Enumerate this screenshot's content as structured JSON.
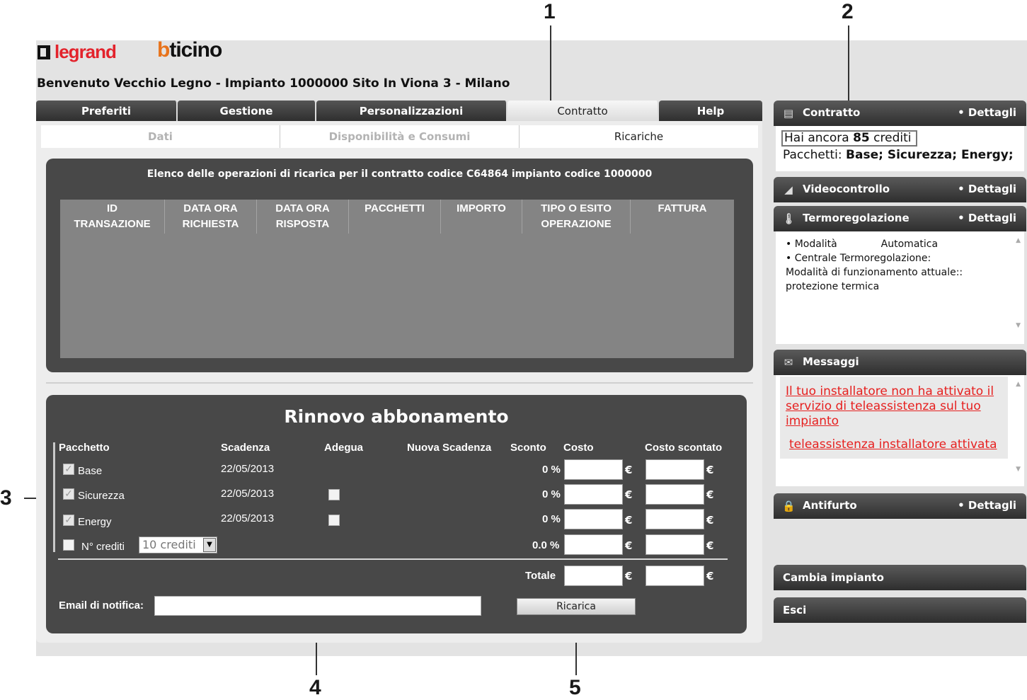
{
  "callouts": [
    "1",
    "2",
    "3",
    "4",
    "5"
  ],
  "brand": {
    "legrand": "legrand",
    "bticino_b": "b",
    "bticino_rest": "ticino"
  },
  "header": {
    "welcome": "Benvenuto Vecchio Legno - Impianto 1000000 Sito In Viona 3 - Milano"
  },
  "main_tabs": [
    {
      "label": "Preferiti",
      "active": false
    },
    {
      "label": "Gestione",
      "active": false
    },
    {
      "label": "Personalizzazioni",
      "active": false
    },
    {
      "label": "Contratto",
      "active": true
    },
    {
      "label": "Help",
      "active": false
    }
  ],
  "sub_tabs": [
    {
      "label": "Dati",
      "active": false
    },
    {
      "label": "Disponibilità e Consumi",
      "active": false
    },
    {
      "label": "Ricariche",
      "active": true
    }
  ],
  "transactions": {
    "title": "Elenco delle operazioni di ricarica per il contratto codice C64864 impianto codice 1000000",
    "columns": [
      {
        "line1": "ID",
        "line2": "TRANSAZIONE"
      },
      {
        "line1": "DATA ORA",
        "line2": "RICHIESTA"
      },
      {
        "line1": "DATA ORA",
        "line2": "RISPOSTA"
      },
      {
        "line1": "PACCHETTI",
        "line2": ""
      },
      {
        "line1": "IMPORTO",
        "line2": ""
      },
      {
        "line1": "TIPO O ESITO",
        "line2": "OPERAZIONE"
      },
      {
        "line1": "FATTURA",
        "line2": ""
      }
    ]
  },
  "renew": {
    "title": "Rinnovo abbonamento",
    "headers": {
      "pacchetto": "Pacchetto",
      "scadenza": "Scadenza",
      "adegua": "Adegua",
      "nuova_scadenza": "Nuova Scadenza",
      "sconto": "Sconto",
      "costo": "Costo",
      "costo_scontato": "Costo scontato"
    },
    "rows": [
      {
        "name": "Base",
        "checked": true,
        "scadenza": "22/05/2013",
        "sconto": "0 %"
      },
      {
        "name": "Sicurezza",
        "checked": true,
        "scadenza": "22/05/2013",
        "sconto": "0 %"
      },
      {
        "name": "Energy",
        "checked": true,
        "scadenza": "22/05/2013",
        "sconto": "0 %"
      }
    ],
    "credits_row": {
      "label": "N° crediti",
      "selected": "10 crediti",
      "sconto": "0.0 %"
    },
    "currency": "€",
    "totale_label": "Totale",
    "email_label": "Email di notifica:",
    "submit_label": "Ricarica"
  },
  "sidebar": {
    "contratto": {
      "title": "Contratto",
      "details": "• Dettagli",
      "credits_prefix": "Hai ancora ",
      "credits_value": "85",
      "credits_suffix": " crediti",
      "packages_label": "Pacchetti: ",
      "packages": "Base; Sicurezza; Energy;"
    },
    "videocontrollo": {
      "title": "Videocontrollo",
      "details": "• Dettagli"
    },
    "termoregolazione": {
      "title": "Termoregolazione",
      "details": "• Dettagli",
      "line1_label": "• Modalità",
      "line1_value": "Automatica",
      "line2": "• Centrale Termoregolazione:",
      "line3": "Modalità di funzionamento attuale::",
      "line4": "protezione termica"
    },
    "messaggi": {
      "title": "Messaggi",
      "msg1": "Il tuo installatore non ha attivato il servizio di teleassistenza sul tuo impianto",
      "msg2": "teleassistenza installatore attivata"
    },
    "antifurto": {
      "title": "Antifurto",
      "details": "• Dettagli"
    },
    "cambia_impianto": "Cambia impianto",
    "esci": "Esci"
  },
  "colors": {
    "panel_dark": "#484848",
    "table_grey": "#848484",
    "message_red": "#e6201f",
    "legrand_red": "#e3232c",
    "bticino_orange": "#e8731b"
  }
}
